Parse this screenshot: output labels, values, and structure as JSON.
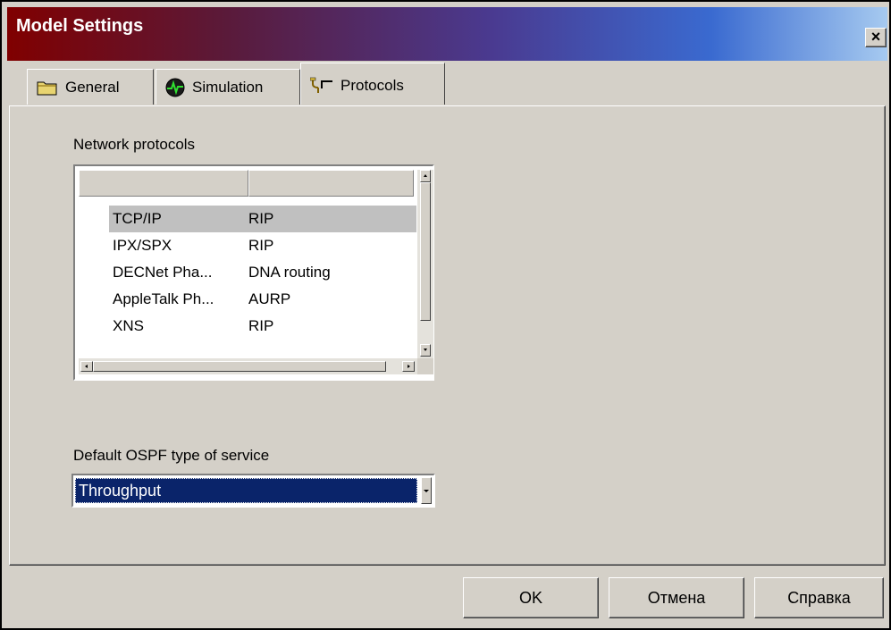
{
  "window": {
    "title": "Model Settings",
    "close_label": "×"
  },
  "tabs": [
    {
      "label": "General",
      "icon": "folder-icon"
    },
    {
      "label": "Simulation",
      "icon": "monitor-waveform-icon"
    },
    {
      "label": "Protocols",
      "icon": "network-cable-icon"
    }
  ],
  "protocols": {
    "label": "Network protocols",
    "rows": [
      {
        "name": "TCP/IP",
        "routing": "RIP"
      },
      {
        "name": "IPX/SPX",
        "routing": "RIP"
      },
      {
        "name": "DECNet Pha...",
        "routing": "DNA routing"
      },
      {
        "name": "AppleTalk Ph...",
        "routing": "AURP"
      },
      {
        "name": "XNS",
        "routing": "RIP"
      }
    ]
  },
  "ospf": {
    "label": "Default OSPF type of service",
    "value": "Throughput"
  },
  "buttons": {
    "ok": "OK",
    "cancel": "Отмена",
    "help": "Справка"
  }
}
